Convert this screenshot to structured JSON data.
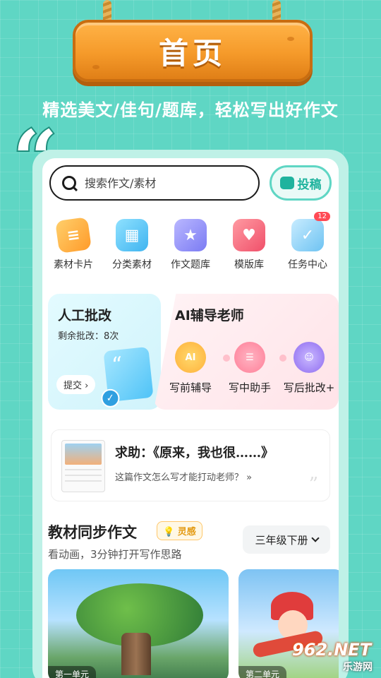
{
  "banner": {
    "title": "首页"
  },
  "tagline": "精选美文/佳句/题库，轻松写出好作文",
  "search": {
    "placeholder": "搜索作文/素材",
    "submit_label": "投稿"
  },
  "categories": [
    {
      "label": "素材卡片",
      "icon": "material-card-icon"
    },
    {
      "label": "分类素材",
      "icon": "category-icon"
    },
    {
      "label": "作文题库",
      "icon": "question-bank-icon"
    },
    {
      "label": "模版库",
      "icon": "template-icon"
    },
    {
      "label": "任务中心",
      "icon": "task-center-icon",
      "badge": "12"
    }
  ],
  "correction": {
    "title": "人工批改",
    "remaining": "剩余批改：8次",
    "button": "提交 ›"
  },
  "ai_tutor": {
    "title": "AI辅导老师",
    "tools": [
      {
        "label": "写前辅导",
        "icon_text": "AI"
      },
      {
        "label": "写中助手",
        "icon_text": ""
      },
      {
        "label": "写后批改+",
        "icon_text": ""
      }
    ]
  },
  "help_card": {
    "title": "求助：《原来，我也很……》",
    "question": "这篇作文怎么写才能打动老师？ »"
  },
  "section": {
    "title": "教材同步作文",
    "badge": "灵感",
    "subtitle": "看动画，3分钟打开写作思路",
    "grade": "三年级下册"
  },
  "units": [
    {
      "label": "第一单元"
    },
    {
      "label": "第二单元"
    }
  ],
  "watermark": {
    "brand": "962.NET",
    "site": "乐游网"
  },
  "colors": {
    "accent": "#5fd6c4",
    "orange": "#f59a2a",
    "badge_red": "#ff4a55"
  }
}
